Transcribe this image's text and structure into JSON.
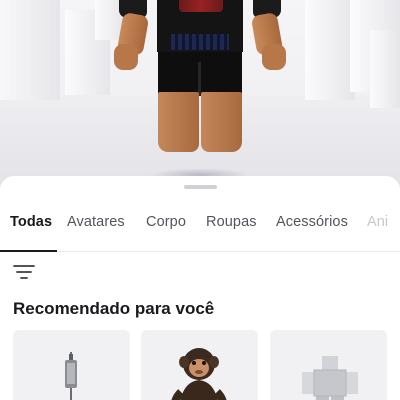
{
  "tabs": [
    {
      "label": "Todas",
      "active": true
    },
    {
      "label": "Avatares",
      "active": false
    },
    {
      "label": "Corpo",
      "active": false
    },
    {
      "label": "Roupas",
      "active": false
    },
    {
      "label": "Acessórios",
      "active": false
    },
    {
      "label": "Ani",
      "active": false
    }
  ],
  "filter": {
    "icon": "filter-icon"
  },
  "recommended": {
    "title": "Recomendado para você",
    "items": [
      {
        "icon": "cable-accessory-icon"
      },
      {
        "icon": "monkey-avatar-icon"
      },
      {
        "icon": "blocky-avatar-icon"
      }
    ]
  },
  "colors": {
    "accent": "#18191c",
    "sheet": "#ffffff",
    "scene": "#f0f0f2"
  }
}
